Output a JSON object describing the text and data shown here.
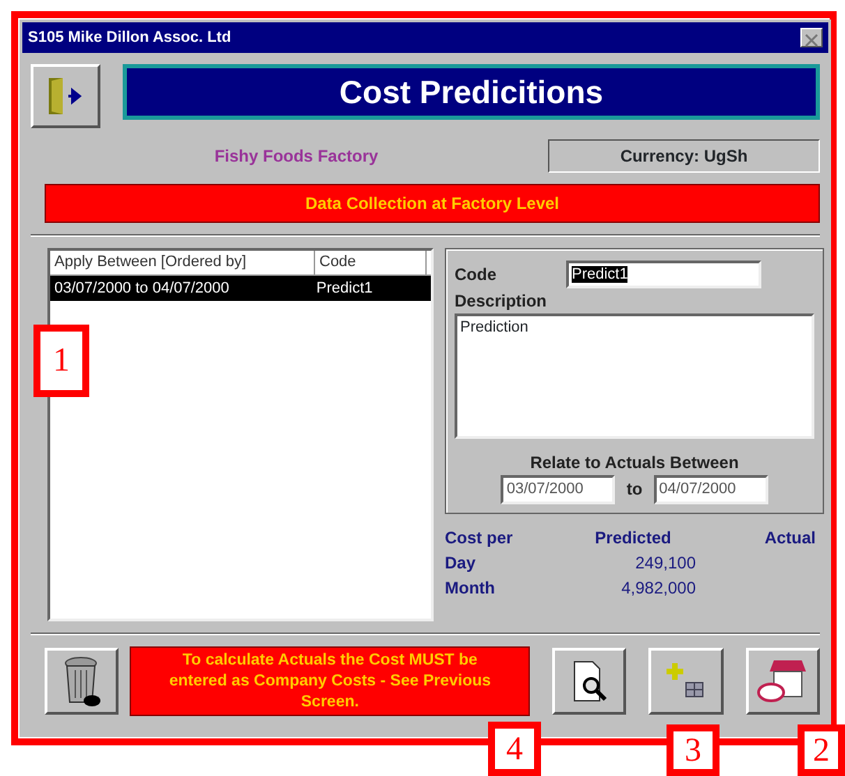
{
  "window": {
    "title": "S105 Mike Dillon Assoc. Ltd"
  },
  "header": {
    "title": "Cost Predicitions",
    "factory": "Fishy Foods Factory",
    "currency": "Currency: UgSh",
    "banner": "Data Collection at Factory Level"
  },
  "list": {
    "columns": [
      "Apply Between [Ordered by]",
      "Code"
    ],
    "rows": [
      {
        "cells": [
          "03/07/2000 to 04/07/2000",
          "Predict1"
        ],
        "selected": true
      }
    ]
  },
  "detail": {
    "code_label": "Code",
    "code_value": "Predict1",
    "description_label": "Description",
    "description": "Prediction",
    "relate_label": "Relate to Actuals Between",
    "date_from": "03/07/2000",
    "to_label": "to",
    "date_to": "04/07/2000"
  },
  "costs": {
    "columns": [
      "Cost per",
      "Predicted",
      "Actual"
    ],
    "rows": [
      {
        "label": "Day",
        "predicted": "249,100"
      },
      {
        "label": "Month",
        "predicted": "4,982,000"
      }
    ]
  },
  "message": "To calculate Actuals the Cost MUST be entered as Company Costs - See Previous Screen.",
  "callouts": [
    {
      "number": "1"
    },
    {
      "number": "4"
    },
    {
      "number": "3"
    },
    {
      "number": "2"
    }
  ]
}
